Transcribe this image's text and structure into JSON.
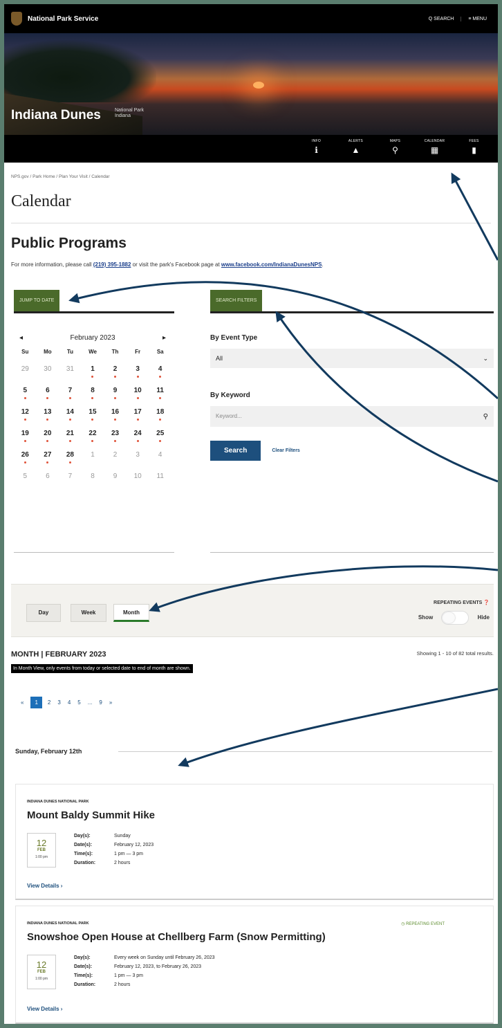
{
  "header": {
    "brand": "National Park Service",
    "search": "Q SEARCH",
    "menu": "≡ MENU"
  },
  "hero": {
    "park_name": "Indiana Dunes",
    "park_type": "National Park",
    "park_state": "Indiana"
  },
  "iconbar": [
    {
      "label": "INFO",
      "icon": "info-icon",
      "glyph": "ℹ"
    },
    {
      "label": "ALERTS",
      "icon": "alert-icon",
      "glyph": "▲"
    },
    {
      "label": "MAPS",
      "icon": "map-pin-icon",
      "glyph": "⚲"
    },
    {
      "label": "CALENDAR",
      "icon": "calendar-icon",
      "glyph": "▦"
    },
    {
      "label": "FEES",
      "icon": "fees-icon",
      "glyph": "▮"
    }
  ],
  "breadcrumb": "NPS.gov / Park Home / Plan Your Visit / Calendar",
  "page_title": "Calendar",
  "section_title": "Public Programs",
  "info": {
    "pre": "For more information, please call ",
    "phone": "(219) 395-1882",
    "mid": " or visit the park's Facebook page at ",
    "link": "www.facebook.com/IndianaDunesNPS",
    "post": "."
  },
  "jump_tab": "JUMP TO DATE",
  "filter_tab": "SEARCH FILTERS",
  "calendar": {
    "prev": "◂",
    "next": "▸",
    "month": "February 2023",
    "dow": [
      "Su",
      "Mo",
      "Tu",
      "We",
      "Th",
      "Fr",
      "Sa"
    ],
    "days": [
      {
        "d": "29",
        "m": true,
        "e": false
      },
      {
        "d": "30",
        "m": true,
        "e": false
      },
      {
        "d": "31",
        "m": true,
        "e": false
      },
      {
        "d": "1",
        "m": false,
        "e": true
      },
      {
        "d": "2",
        "m": false,
        "e": true
      },
      {
        "d": "3",
        "m": false,
        "e": true
      },
      {
        "d": "4",
        "m": false,
        "e": true
      },
      {
        "d": "5",
        "m": false,
        "e": true
      },
      {
        "d": "6",
        "m": false,
        "e": true
      },
      {
        "d": "7",
        "m": false,
        "e": true
      },
      {
        "d": "8",
        "m": false,
        "e": true
      },
      {
        "d": "9",
        "m": false,
        "e": true
      },
      {
        "d": "10",
        "m": false,
        "e": true
      },
      {
        "d": "11",
        "m": false,
        "e": true
      },
      {
        "d": "12",
        "m": false,
        "e": true
      },
      {
        "d": "13",
        "m": false,
        "e": true
      },
      {
        "d": "14",
        "m": false,
        "e": true
      },
      {
        "d": "15",
        "m": false,
        "e": true
      },
      {
        "d": "16",
        "m": false,
        "e": true
      },
      {
        "d": "17",
        "m": false,
        "e": true
      },
      {
        "d": "18",
        "m": false,
        "e": true
      },
      {
        "d": "19",
        "m": false,
        "e": true
      },
      {
        "d": "20",
        "m": false,
        "e": true
      },
      {
        "d": "21",
        "m": false,
        "e": true
      },
      {
        "d": "22",
        "m": false,
        "e": true
      },
      {
        "d": "23",
        "m": false,
        "e": true
      },
      {
        "d": "24",
        "m": false,
        "e": true
      },
      {
        "d": "25",
        "m": false,
        "e": true
      },
      {
        "d": "26",
        "m": false,
        "e": true
      },
      {
        "d": "27",
        "m": false,
        "e": true
      },
      {
        "d": "28",
        "m": false,
        "e": true
      },
      {
        "d": "1",
        "m": true,
        "e": false
      },
      {
        "d": "2",
        "m": true,
        "e": false
      },
      {
        "d": "3",
        "m": true,
        "e": false
      },
      {
        "d": "4",
        "m": true,
        "e": false
      },
      {
        "d": "5",
        "m": true,
        "e": false
      },
      {
        "d": "6",
        "m": true,
        "e": false
      },
      {
        "d": "7",
        "m": true,
        "e": false
      },
      {
        "d": "8",
        "m": true,
        "e": false
      },
      {
        "d": "9",
        "m": true,
        "e": false
      },
      {
        "d": "10",
        "m": true,
        "e": false
      },
      {
        "d": "11",
        "m": true,
        "e": false
      }
    ]
  },
  "filters": {
    "event_type_label": "By Event Type",
    "event_type_value": "All",
    "keyword_label": "By Keyword",
    "keyword_placeholder": "Keyword...",
    "search_button": "Search",
    "clear": "Clear Filters"
  },
  "view": {
    "day": "Day",
    "week": "Week",
    "month": "Month",
    "repeating_label": "REPEATING EVENTS",
    "show": "Show",
    "hide": "Hide"
  },
  "month_header": "MONTH  |  FEBRUARY 2023",
  "showing": "Showing 1 - 10 of 82 total results.",
  "notice": "In Month View, only events from today or selected date to end of month are shown.",
  "pager": [
    "«",
    "1",
    "2",
    "3",
    "4",
    "5",
    "...",
    "9",
    "»"
  ],
  "date_header": "Sunday, February 12th",
  "events": [
    {
      "location": "INDIANA DUNES NATIONAL PARK",
      "title": "Mount Baldy Summit Hike",
      "day_num": "12",
      "mon": "FEB",
      "time_short": "1:00 pm",
      "days": "Sunday",
      "dates": "February 12, 2023",
      "times": "1 pm — 3 pm",
      "duration": "2 hours",
      "details": "View Details ›",
      "repeating": ""
    },
    {
      "location": "INDIANA DUNES NATIONAL PARK",
      "title": "Snowshoe Open House at Chellberg Farm (Snow Permitting)",
      "day_num": "12",
      "mon": "FEB",
      "time_short": "1:00 pm",
      "days": "Every week on Sunday until February 26, 2023",
      "dates": "February 12, 2023, to February 26, 2023",
      "times": "1 pm — 3 pm",
      "duration": "2 hours",
      "details": "View Details ›",
      "repeating": "◷ REPEATING EVENT"
    }
  ],
  "meta_keys": {
    "days": "Day(s):",
    "dates": "Date(s):",
    "times": "Time(s):",
    "duration": "Duration:"
  },
  "colors": {
    "frame": "#5a7d6e",
    "tab_green": "#4a6a2a",
    "button_blue": "#1d4f7d",
    "arrow": "#123a5e",
    "dot": "#e0533a"
  }
}
